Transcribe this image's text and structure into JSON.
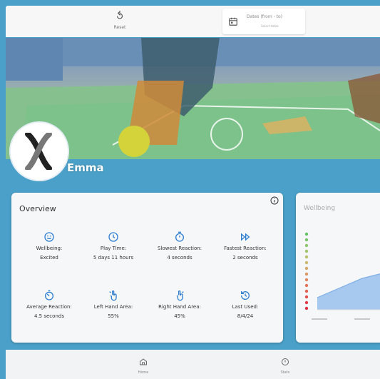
{
  "toolbar": {
    "reset_label": "Reset"
  },
  "date_picker": {
    "range_label": "Dates (from - to)",
    "hint": "Select dates"
  },
  "profile": {
    "name": "Emma"
  },
  "overview": {
    "title": "Overview",
    "stats": [
      {
        "icon": "smiley-face-icon",
        "label": "Wellbeing:",
        "value": "Excited"
      },
      {
        "icon": "clock-icon",
        "label": "Play Time:",
        "value": "5 days 11 hours"
      },
      {
        "icon": "stopwatch-icon",
        "label": "Slowest Reaction:",
        "value": "4 seconds"
      },
      {
        "icon": "fast-forward-icon",
        "label": "Fastest Reaction:",
        "value": "2 seconds"
      },
      {
        "icon": "timer-icon",
        "label": "Average Reaction:",
        "value": "4.5 seconds"
      },
      {
        "icon": "hand-pointer-left-icon",
        "label": "Left Hand Area:",
        "value": "55%"
      },
      {
        "icon": "hand-pointer-right-icon",
        "label": "Right Hand Area:",
        "value": "45%"
      },
      {
        "icon": "history-icon",
        "label": "Last Used:",
        "value": "8/4/24"
      }
    ]
  },
  "wellbeing": {
    "title": "Wellbeing"
  },
  "nav": {
    "home_label": "Home",
    "stats_label": "Stats"
  },
  "colors": {
    "accent": "#2f7fd0",
    "background": "#4aa0c8"
  }
}
